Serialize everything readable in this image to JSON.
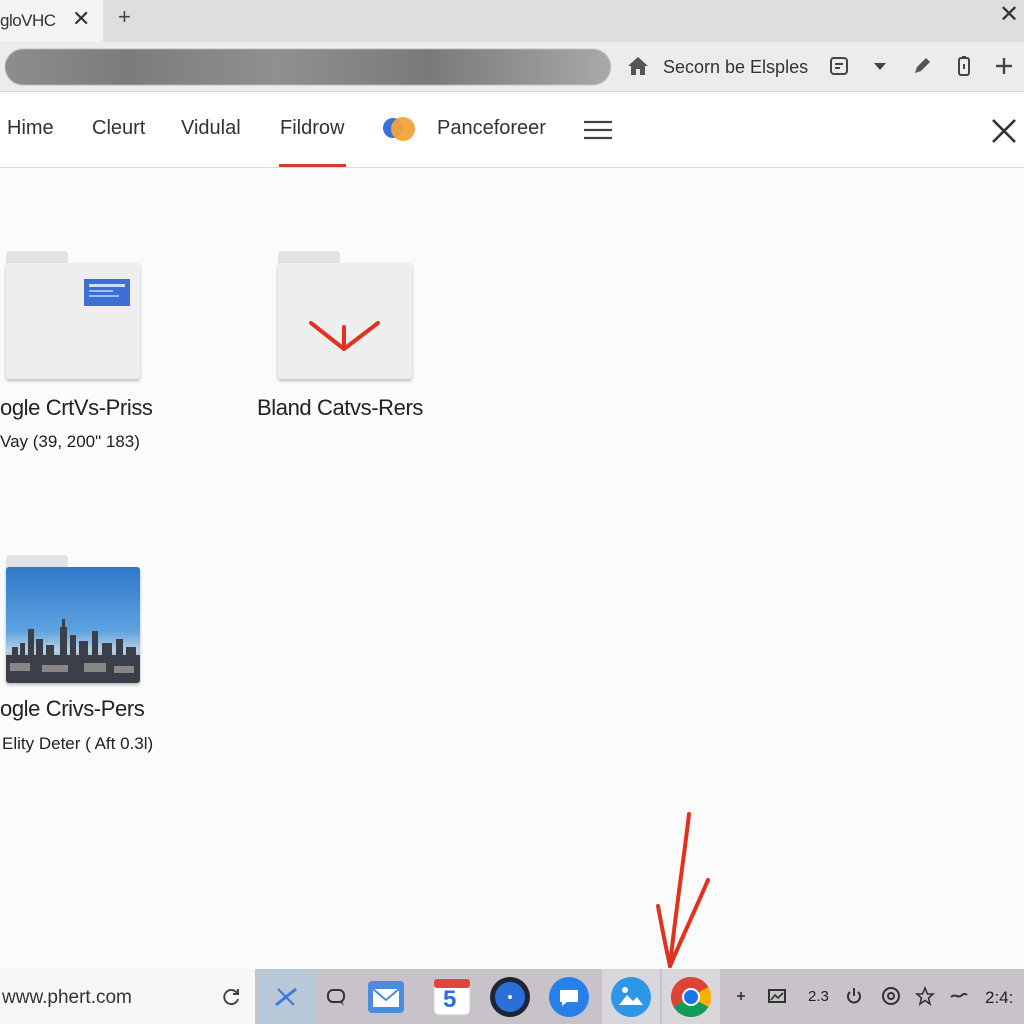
{
  "browser": {
    "tab_title": "gloVHC",
    "tab_close_glyph": "✕",
    "new_tab_glyph": "+",
    "window_close_glyph": "✕",
    "toolbar_home_label": "Secorn be Elsples",
    "toolbar_icons": [
      "home-icon",
      "reader-icon",
      "dropdown-icon",
      "pen-icon",
      "battery-icon",
      "plus-icon"
    ]
  },
  "nav": {
    "tabs": [
      "Hime",
      "Cleurt",
      "Vidulal",
      "Fildrow",
      "Panceforeer"
    ],
    "active_tab": "Fildrow",
    "accent_color": "#d83a2e"
  },
  "files": [
    {
      "name": "ogle CrtVs-Priss",
      "meta": "Vay (39, 200\" 183)",
      "thumbnail": "blue-document"
    },
    {
      "name": "Bland Catvs-Rers",
      "meta": "",
      "thumbnail": "red-chevron"
    },
    {
      "name": "ogle Crivs-Pers",
      "meta": "Elity Deter ( Aft 0.3l)",
      "thumbnail": "city-skyline"
    }
  ],
  "taskbar": {
    "url": "www.phert.com",
    "apps": [
      "cross-app-icon",
      "chat-icon",
      "mail-app-icon",
      "calendar-app-icon",
      "compass-app-icon",
      "messages-app-icon",
      "photos-app-icon",
      "chrome-app-icon"
    ],
    "calendar_number": "5",
    "tray_number": "2.3",
    "clock": "2:4:"
  },
  "colors": {
    "annotation": "#e0321f",
    "chrome_blue": "#1a73e8"
  }
}
